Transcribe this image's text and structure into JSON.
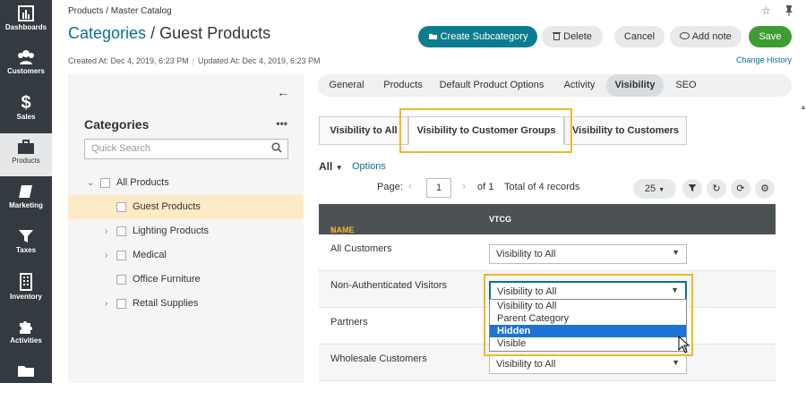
{
  "sidebar": {
    "items": [
      {
        "label": "Dashboards",
        "icon": "dashboard-icon"
      },
      {
        "label": "Customers",
        "icon": "customers-icon"
      },
      {
        "label": "Sales",
        "icon": "dollar-icon"
      },
      {
        "label": "Products",
        "icon": "briefcase-icon"
      },
      {
        "label": "Marketing",
        "icon": "book-icon"
      },
      {
        "label": "Taxes",
        "icon": "filter-icon"
      },
      {
        "label": "Inventory",
        "icon": "building-icon"
      },
      {
        "label": "Activities",
        "icon": "puzzle-icon"
      },
      {
        "label": "",
        "icon": "folder-icon"
      }
    ]
  },
  "header": {
    "breadcrumb": "Products / Master Catalog",
    "title_link": "Categories",
    "title_sep": "/",
    "title": "Guest Products",
    "created": "Created At: Dec 4, 2019, 6:23 PM",
    "meta_sep": "|",
    "updated": "Updated At: Dec 4, 2019, 6:23 PM",
    "change_history": "Change History",
    "buttons": {
      "create": "Create Subcategory",
      "delete": "Delete",
      "cancel": "Cancel",
      "add_note": "Add note",
      "save": "Save"
    }
  },
  "tree": {
    "title": "Categories",
    "more": "•••",
    "search_placeholder": "Quick Search",
    "nodes": [
      {
        "label": "All Products",
        "caret": "⌄"
      },
      {
        "label": "Guest Products",
        "caret": ""
      },
      {
        "label": "Lighting Products",
        "caret": "›"
      },
      {
        "label": "Medical",
        "caret": "›"
      },
      {
        "label": "Office Furniture",
        "caret": ""
      },
      {
        "label": "Retail Supplies",
        "caret": "›"
      }
    ]
  },
  "tabs": [
    "General",
    "Products",
    "Default Product Options",
    "Activity",
    "Visibility",
    "SEO"
  ],
  "visibility_tabs": [
    "Visibility to All",
    "Visibility to Customer Groups",
    "Visibility to Customers"
  ],
  "filter": {
    "all": "All",
    "options": "Options"
  },
  "pager": {
    "page_label": "Page:",
    "page": "1",
    "of": "of 1",
    "total": "Total of 4 records",
    "per_page": "25"
  },
  "table": {
    "col_name": "NAME",
    "col_vtcg": "VTCG",
    "rows": [
      {
        "name": "All Customers",
        "value": "Visibility to All"
      },
      {
        "name": "Non-Authenticated Visitors",
        "value": "Visibility to All"
      },
      {
        "name": "Partners",
        "value": ""
      },
      {
        "name": "Wholesale Customers",
        "value": "Visibility to All"
      }
    ]
  },
  "dropdown": {
    "options": [
      "Visibility to All",
      "Parent Category",
      "Hidden",
      "Visible"
    ],
    "highlighted": "Hidden"
  },
  "colors": {
    "accent": "#0c7d8e",
    "save": "#3f9c35",
    "highlight": "#f0b82a",
    "link": "#0a6f96"
  }
}
